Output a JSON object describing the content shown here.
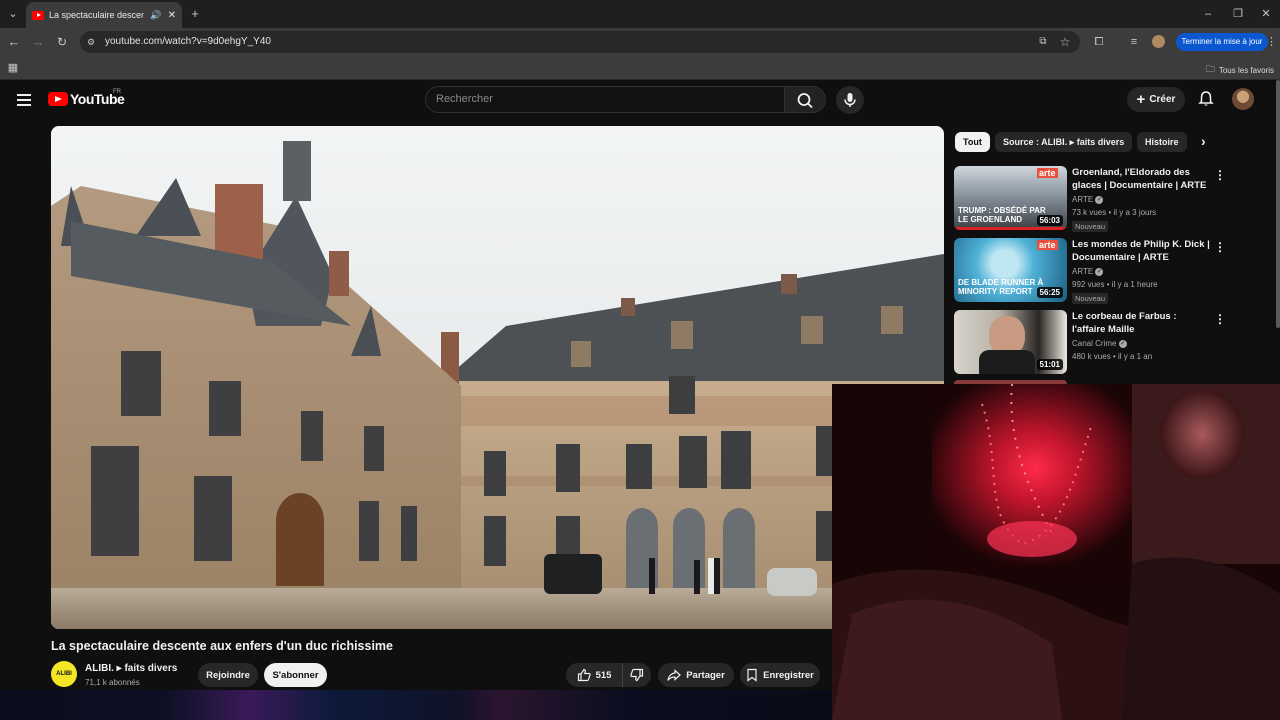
{
  "browser": {
    "tab_title": "La spectaculaire descente a",
    "url": "youtube.com/watch?v=9d0ehgY_Y40",
    "update_button": "Terminer la mise à jour",
    "bookmarks_all": "Tous les favoris"
  },
  "header": {
    "logo": "YouTube",
    "region": "FR",
    "search_placeholder": "Rechercher",
    "create_label": "Créer"
  },
  "video": {
    "title": "La spectaculaire descente aux enfers d'un duc richissime",
    "channel_name": "ALIBI. ▸ faits divers",
    "channel_avatar_text": "ALIBI",
    "subscribers": "71,1 k abonnés",
    "join_label": "Rejoindre",
    "subscribe_label": "S'abonner",
    "likes": "515",
    "share_label": "Partager",
    "save_label": "Enregistrer"
  },
  "chips": [
    "Tout",
    "Source : ALIBI. ▸ faits divers",
    "Histoire"
  ],
  "recommendations": [
    {
      "title": "Groenland, l'Eldorado des glaces | Documentaire | ARTE",
      "channel": "ARTE",
      "meta": "73 k vues • il y a 3 jours",
      "badge": "Nouveau",
      "duration": "56:03",
      "thumb_text": "TRUMP : OBSÉDÉ PAR LE GROENLAND",
      "thumb_logo": "arte"
    },
    {
      "title": "Les mondes de Philip K. Dick | Documentaire | ARTE",
      "channel": "ARTE",
      "meta": "992 vues • il y a 1 heure",
      "badge": "Nouveau",
      "duration": "56:25",
      "thumb_text": "DE BLADE RUNNER À MINORITY REPORT",
      "thumb_logo": "arte"
    },
    {
      "title": "Le corbeau de Farbus : l'affaire Maille",
      "channel": "Canal Crime",
      "meta": "480 k vues • il y a 1 an",
      "badge": "",
      "duration": "51:01",
      "thumb_text": "",
      "thumb_logo": ""
    }
  ]
}
